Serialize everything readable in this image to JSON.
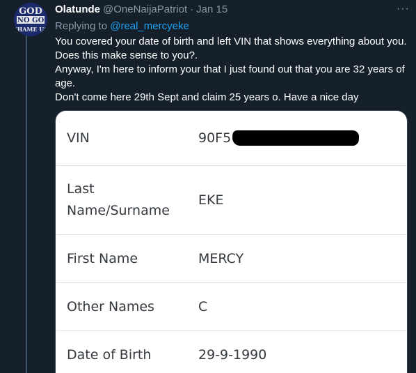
{
  "tweet": {
    "display_name": "Olatunde",
    "handle": "@OneNaijaPatriot",
    "separator": "·",
    "date": "Jan 15",
    "more_label": "···",
    "reply_prefix": "Replying to",
    "reply_mention": "@real_mercyeke",
    "text_lines": [
      "You covered your date of birth and left VIN that shows everything about you. Does this make sense to you?.",
      "Anyway, I'm here to inform your that I just found out that you are 32 years of age.",
      "Don't come here 29th Sept and claim 25 years o. Have a nice day"
    ],
    "avatar": {
      "icon": "god-no-go-shame-us-icon",
      "lines": [
        "GOD",
        "NO GO",
        "SHAME US"
      ]
    }
  },
  "vin_card": {
    "rows": [
      {
        "label": "VIN",
        "value": "90F5",
        "redacted": true
      },
      {
        "label": "Last Name/Surname",
        "value": "EKE"
      },
      {
        "label": "First Name",
        "value": "MERCY"
      },
      {
        "label": "Other Names",
        "value": "C"
      },
      {
        "label": "Date of Birth",
        "value": "29-9-1990"
      }
    ]
  },
  "colors": {
    "background": "#15202b",
    "secondary_text": "#8899a6",
    "link": "#1da1f2",
    "card_border": "#38444d",
    "table_text": "#343a40"
  }
}
